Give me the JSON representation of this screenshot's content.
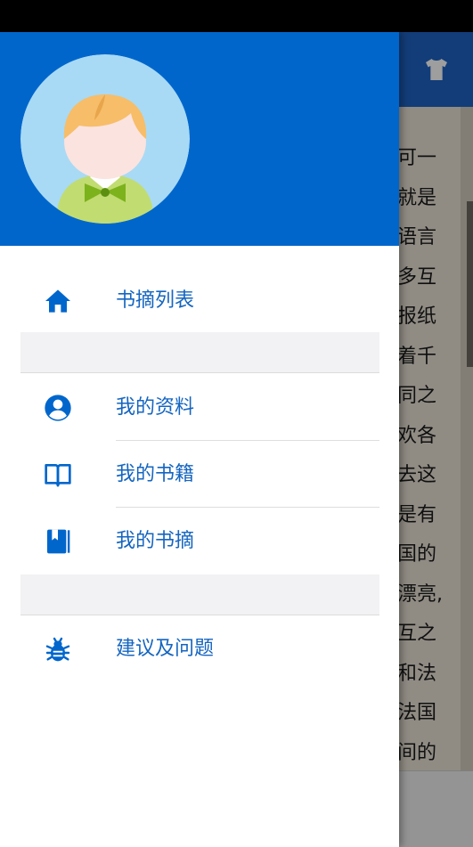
{
  "background_page": {
    "text_lines": [
      "可一",
      "就是",
      "语言",
      "多互",
      "报纸",
      "着千",
      "同之",
      "欢各",
      "去这",
      "是有",
      "国的",
      "漂亮,",
      "互之",
      "和法",
      "法国",
      "间的"
    ],
    "toolbar_icon": "shirt-icon"
  },
  "drawer": {
    "header_color": "#0066cc",
    "avatar_icon": "avatar-boy-icon",
    "menu": {
      "digest_list": {
        "label": "书摘列表",
        "icon": "home-icon"
      },
      "my_profile": {
        "label": "我的资料",
        "icon": "account-circle-icon"
      },
      "my_books": {
        "label": "我的书籍",
        "icon": "open-book-icon"
      },
      "my_digests": {
        "label": "我的书摘",
        "icon": "bookmark-book-icon"
      },
      "feedback": {
        "label": "建议及问题",
        "icon": "bug-icon"
      }
    },
    "accent_color": "#1565c0"
  }
}
